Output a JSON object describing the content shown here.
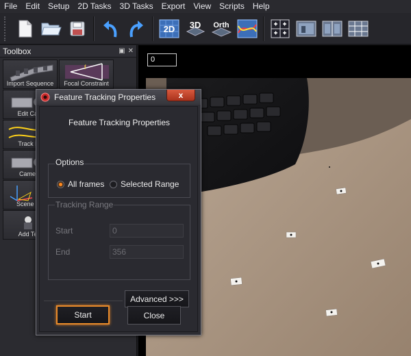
{
  "menu": [
    "File",
    "Edit",
    "Setup",
    "2D Tasks",
    "3D Tasks",
    "Export",
    "View",
    "Scripts",
    "Help"
  ],
  "toolbar": {
    "buttons": [
      {
        "name": "new-icon"
      },
      {
        "name": "open-icon"
      },
      {
        "name": "save-icon"
      },
      {
        "name": "undo-icon"
      },
      {
        "name": "redo-icon"
      },
      {
        "name": "2d-view-icon",
        "label": "2D"
      },
      {
        "name": "3d-view-icon",
        "label": "3D"
      },
      {
        "name": "ortho-view-icon",
        "label": "Orth"
      },
      {
        "name": "curve-view-icon"
      },
      {
        "name": "grid-layout-icon"
      },
      {
        "name": "single-frame-icon"
      },
      {
        "name": "split-frame-icon"
      },
      {
        "name": "multi-frame-icon"
      }
    ]
  },
  "toolbox": {
    "title": "Toolbox",
    "tools": [
      {
        "label": "Import Sequence"
      },
      {
        "label": "Focal Constraint"
      },
      {
        "label": "Edit Cam"
      },
      {
        "label": "Track Fe"
      },
      {
        "label": "Camera"
      },
      {
        "label": "Scene Ge"
      },
      {
        "label": "Add Test"
      }
    ]
  },
  "viewport": {
    "frame": "0"
  },
  "dialog": {
    "title": "Feature Tracking Properties",
    "close_label": "x",
    "heading": "Feature Tracking Properties",
    "options": {
      "title": "Options",
      "all_frames": "All frames",
      "selected_range": "Selected Range",
      "selected": "all_frames"
    },
    "range": {
      "title": "Tracking Range",
      "start_label": "Start",
      "start_value": "0",
      "end_label": "End",
      "end_value": "356"
    },
    "advanced_label": "Advanced >>>",
    "start_label": "Start",
    "close_button_label": "Close"
  },
  "colors": {
    "accent": "#ff8a1f",
    "background": "#2b2b30"
  }
}
